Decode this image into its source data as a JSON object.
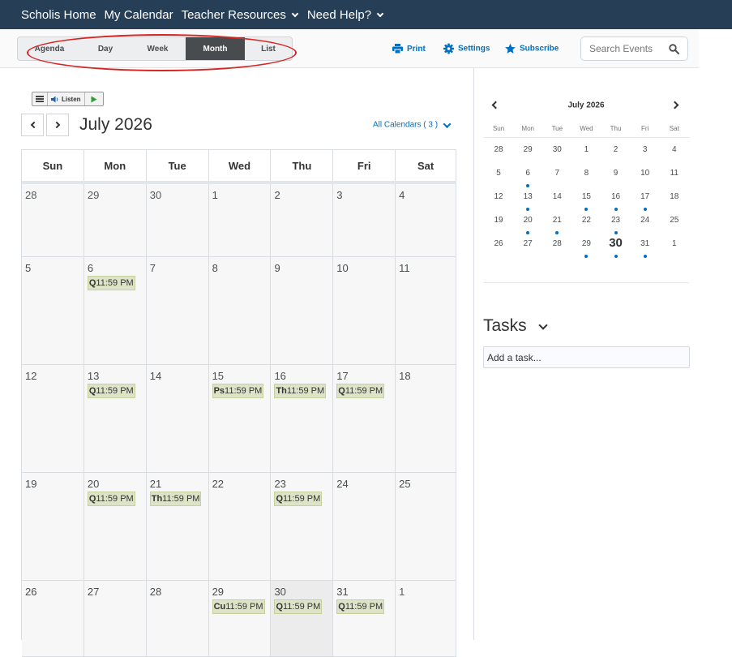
{
  "topnav": {
    "home": "Scholis Home",
    "calendar": "My Calendar",
    "resources": "Teacher Resources",
    "help": "Need Help?"
  },
  "toolbar": {
    "tabs": [
      {
        "label": "Agenda",
        "active": false
      },
      {
        "label": "Day",
        "active": false
      },
      {
        "label": "Week",
        "active": false
      },
      {
        "label": "Month",
        "active": true
      },
      {
        "label": "List",
        "active": false
      }
    ],
    "print": "Print",
    "settings": "Settings",
    "subscribe": "Subscribe",
    "search_placeholder": "Search Events",
    "accent_color": "#006fbf"
  },
  "listen": {
    "label": "Listen"
  },
  "main": {
    "month_title": "July 2026",
    "all_calendars": "All Calendars ( 3 )",
    "weekdays": [
      "Sun",
      "Mon",
      "Tue",
      "Wed",
      "Thu",
      "Fri",
      "Sat"
    ],
    "weeks": [
      [
        {
          "d": "28",
          "other": true
        },
        {
          "d": "29",
          "other": true
        },
        {
          "d": "30",
          "other": true
        },
        {
          "d": "1"
        },
        {
          "d": "2"
        },
        {
          "d": "3"
        },
        {
          "d": "4"
        }
      ],
      [
        {
          "d": "5"
        },
        {
          "d": "6",
          "evt": {
            "code": "Q",
            "time": "11:59 PM"
          }
        },
        {
          "d": "7"
        },
        {
          "d": "8"
        },
        {
          "d": "9"
        },
        {
          "d": "10"
        },
        {
          "d": "11"
        }
      ],
      [
        {
          "d": "12"
        },
        {
          "d": "13",
          "evt": {
            "code": "Q",
            "time": "11:59 PM"
          }
        },
        {
          "d": "14"
        },
        {
          "d": "15",
          "evt": {
            "code": "Ps",
            "time": "11:59 PM"
          }
        },
        {
          "d": "16",
          "evt": {
            "code": "Th",
            "time": "11:59 PM"
          }
        },
        {
          "d": "17",
          "evt": {
            "code": "Q",
            "time": "11:59 PM"
          }
        },
        {
          "d": "18"
        }
      ],
      [
        {
          "d": "19"
        },
        {
          "d": "20",
          "evt": {
            "code": "Q",
            "time": "11:59 PM"
          }
        },
        {
          "d": "21",
          "evt": {
            "code": "Th",
            "time": "11:59 PM"
          }
        },
        {
          "d": "22"
        },
        {
          "d": "23",
          "evt": {
            "code": "Q",
            "time": "11:59 PM"
          }
        },
        {
          "d": "24"
        },
        {
          "d": "25"
        }
      ],
      [
        {
          "d": "26"
        },
        {
          "d": "27"
        },
        {
          "d": "28"
        },
        {
          "d": "29",
          "evt": {
            "code": "Cu",
            "time": "11:59 PM"
          }
        },
        {
          "d": "30",
          "today": true,
          "evt": {
            "code": "Q",
            "time": "11:59 PM"
          }
        },
        {
          "d": "31",
          "evt": {
            "code": "Q",
            "time": "11:59 PM"
          }
        },
        {
          "d": "1",
          "other": true
        }
      ]
    ]
  },
  "mini": {
    "title": "July 2026",
    "weekdays": [
      "Sun",
      "Mon",
      "Tue",
      "Wed",
      "Thu",
      "Fri",
      "Sat"
    ],
    "weeks": [
      [
        {
          "d": "28"
        },
        {
          "d": "29"
        },
        {
          "d": "30"
        },
        {
          "d": "1"
        },
        {
          "d": "2"
        },
        {
          "d": "3"
        },
        {
          "d": "4"
        }
      ],
      [
        {
          "d": "5"
        },
        {
          "d": "6",
          "dot": true
        },
        {
          "d": "7"
        },
        {
          "d": "8"
        },
        {
          "d": "9"
        },
        {
          "d": "10"
        },
        {
          "d": "11"
        }
      ],
      [
        {
          "d": "12"
        },
        {
          "d": "13",
          "dot": true
        },
        {
          "d": "14"
        },
        {
          "d": "15",
          "dot": true
        },
        {
          "d": "16",
          "dot": true
        },
        {
          "d": "17",
          "dot": true
        },
        {
          "d": "18"
        }
      ],
      [
        {
          "d": "19"
        },
        {
          "d": "20",
          "dot": true
        },
        {
          "d": "21",
          "dot": true
        },
        {
          "d": "22"
        },
        {
          "d": "23",
          "dot": true
        },
        {
          "d": "24"
        },
        {
          "d": "25"
        }
      ],
      [
        {
          "d": "26"
        },
        {
          "d": "27"
        },
        {
          "d": "28"
        },
        {
          "d": "29",
          "dot": true
        },
        {
          "d": "30",
          "today": true,
          "dot": true
        },
        {
          "d": "31",
          "dot": true
        },
        {
          "d": "1"
        }
      ]
    ]
  },
  "tasks": {
    "title": "Tasks",
    "add_placeholder": "Add a task..."
  }
}
